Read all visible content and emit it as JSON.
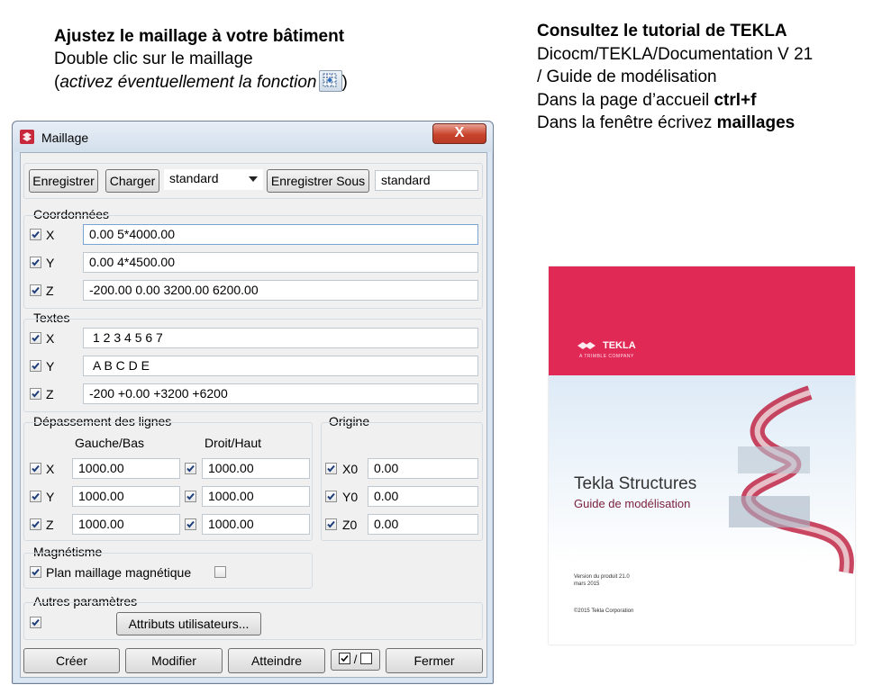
{
  "instructions": {
    "line1": "Ajustez le maillage à votre bâtiment",
    "line2": "Double clic sur le maillage",
    "line3_open": "(",
    "line3_italic": "activez éventuellement la fonction",
    "line3_close": ")"
  },
  "tutorial": {
    "line1_prefix": "Consultez le tutorial de ",
    "line1_bold": "TEKLA",
    "line2": "Dicocm/TEKLA/Documentation V 21",
    "line3": "/ Guide de modélisation",
    "line4_prefix": "Dans la page d’accueil  ",
    "line4_bold": "ctrl+f",
    "line5_prefix": "Dans la fenêtre écrivez ",
    "line5_bold": "maillages"
  },
  "dialog": {
    "title": "Maillage",
    "close": "X",
    "toolbar": {
      "save": "Enregistrer",
      "load": "Charger",
      "preset": "standard",
      "save_as": "Enregistrer Sous",
      "save_as_name": "standard"
    },
    "coordonnees": {
      "label": "Coordonnées",
      "rows": [
        {
          "axis": "X",
          "value": "0.00 5*4000.00"
        },
        {
          "axis": "Y",
          "value": "0.00 4*4500.00"
        },
        {
          "axis": "Z",
          "value": "-200.00 0.00 3200.00 6200.00"
        }
      ]
    },
    "textes": {
      "label": "Textes",
      "rows": [
        {
          "axis": "X",
          "value": "1 2 3 4 5 6 7"
        },
        {
          "axis": "Y",
          "value": "A B C D E"
        },
        {
          "axis": "Z",
          "value": "-200 +0.00 +3200 +6200"
        }
      ]
    },
    "depassement": {
      "label": "Dépassement des lignes",
      "col1": "Gauche/Bas",
      "col2": "Droit/Haut",
      "rows": [
        {
          "axis": "X",
          "left": "1000.00",
          "right": "1000.00"
        },
        {
          "axis": "Y",
          "left": "1000.00",
          "right": "1000.00"
        },
        {
          "axis": "Z",
          "left": "1000.00",
          "right": "1000.00"
        }
      ]
    },
    "origine": {
      "label": "Origine",
      "rows": [
        {
          "axis": "X0",
          "value": "0.00"
        },
        {
          "axis": "Y0",
          "value": "0.00"
        },
        {
          "axis": "Z0",
          "value": "0.00"
        }
      ]
    },
    "magnetisme": {
      "label": "Magnétisme",
      "option": "Plan maillage magnétique"
    },
    "autres": {
      "label": "Autres paramètres",
      "button": "Attributs utilisateurs..."
    },
    "footer": {
      "create": "Créer",
      "modify": "Modifier",
      "reach": "Atteindre",
      "toggle": "/",
      "close": "Fermer"
    }
  },
  "cover": {
    "brand": "TEKLA",
    "brand_sub": "A TRIMBLE COMPANY",
    "title": "Tekla Structures",
    "subtitle": "Guide de modélisation",
    "version": "Version du produit 21.0",
    "date": "mars 2015",
    "copyright": "©2015 Tekla Corporation"
  }
}
